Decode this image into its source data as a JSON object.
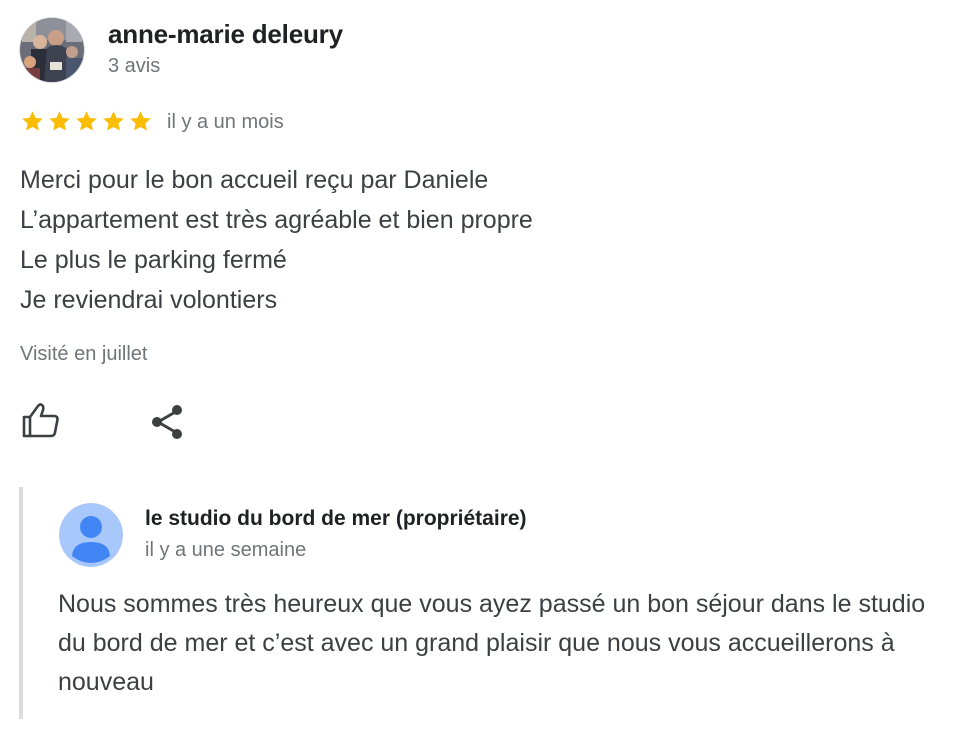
{
  "review": {
    "author": {
      "name": "anne-marie deleury",
      "reviews_count": "3 avis",
      "avatar_icon": "user-photo-icon"
    },
    "rating": {
      "stars": 5,
      "max": 5,
      "star_color": "#fbbc04",
      "date": "il y a un mois"
    },
    "text_lines": [
      "Merci pour le bon accueil reçu par Daniele",
      "L’appartement est très agréable et bien propre",
      "Le plus le parking fermé",
      "Je reviendrai volontiers"
    ],
    "visited": "Visité en juillet",
    "actions": {
      "like_icon": "thumbs-up-icon",
      "share_icon": "share-icon"
    }
  },
  "owner_reply": {
    "name": "le studio du bord de mer (propriétaire)",
    "date": "il y a une semaine",
    "text": "Nous sommes très heureux que vous ayez passé un bon séjour dans le studio du bord de mer et c’est avec un grand plaisir que nous vous accueillerons à nouveau",
    "avatar_icon": "default-user-icon",
    "avatar_color": "#a8c7fa",
    "avatar_figure_color": "#4285f4"
  },
  "colors": {
    "primary_text": "#3c4043",
    "heading_text": "#202124",
    "secondary_text": "#70757a",
    "divider": "#dadce0"
  }
}
